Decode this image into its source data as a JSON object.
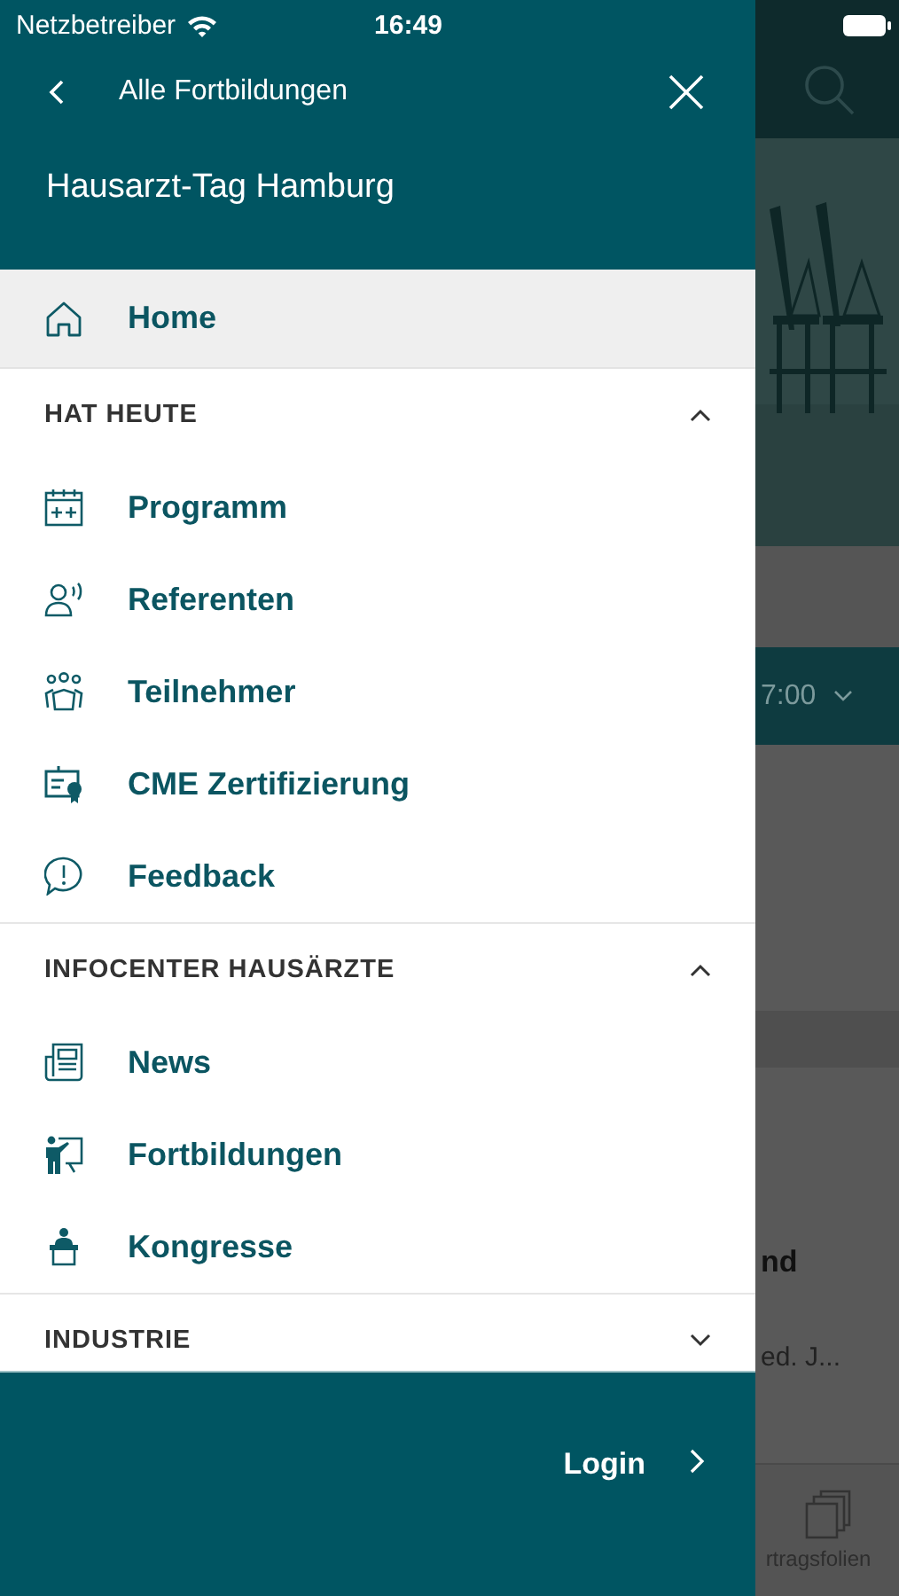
{
  "status_bar": {
    "carrier": "Netzbetreiber",
    "time": "16:49"
  },
  "drawer": {
    "back_label": "Alle Fortbildungen",
    "title": "Hausarzt-Tag Hamburg",
    "home": {
      "label": "Home",
      "selected": true
    },
    "sections": [
      {
        "title": "HAT HEUTE",
        "expanded": true,
        "items": [
          {
            "label": "Programm",
            "selected": false
          },
          {
            "label": "Referenten",
            "selected": false
          },
          {
            "label": "Teilnehmer",
            "selected": false
          },
          {
            "label": "CME Zertifizierung",
            "selected": false
          },
          {
            "label": "Feedback",
            "selected": false
          }
        ]
      },
      {
        "title": "INFOCENTER HAUSÄRZTE",
        "expanded": true,
        "items": [
          {
            "label": "News",
            "selected": false
          },
          {
            "label": "Fortbildungen",
            "selected": false
          },
          {
            "label": "Kongresse",
            "selected": false
          }
        ]
      },
      {
        "title": "INDUSTRIE",
        "expanded": false
      }
    ],
    "login": "Login"
  },
  "background": {
    "time_filter": "7:00",
    "heading": "nd",
    "subtitle": "ed. J...",
    "tab_label": "rtragsfolien"
  }
}
